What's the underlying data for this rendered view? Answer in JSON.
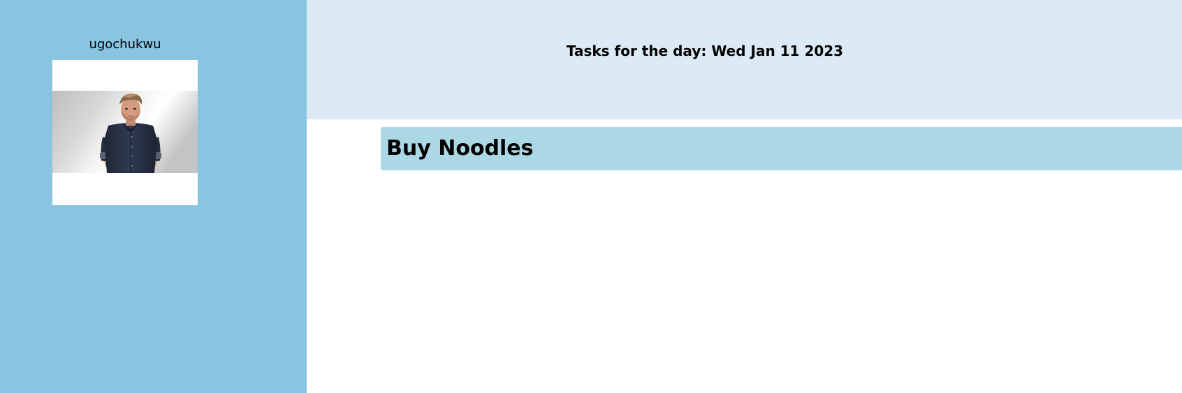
{
  "sidebar": {
    "username": "ugochukwu",
    "avatar_icon": "avatar-photo"
  },
  "header": {
    "title": "Tasks for the day: Wed Jan 11 2023"
  },
  "tasks": [
    {
      "text": "Buy Noodles"
    }
  ],
  "colors": {
    "sidebar_bg": "#89c4e1",
    "header_bg": "#dbeaf4",
    "task_bg": "#acd8e6",
    "page_bg": "#ffffff"
  }
}
